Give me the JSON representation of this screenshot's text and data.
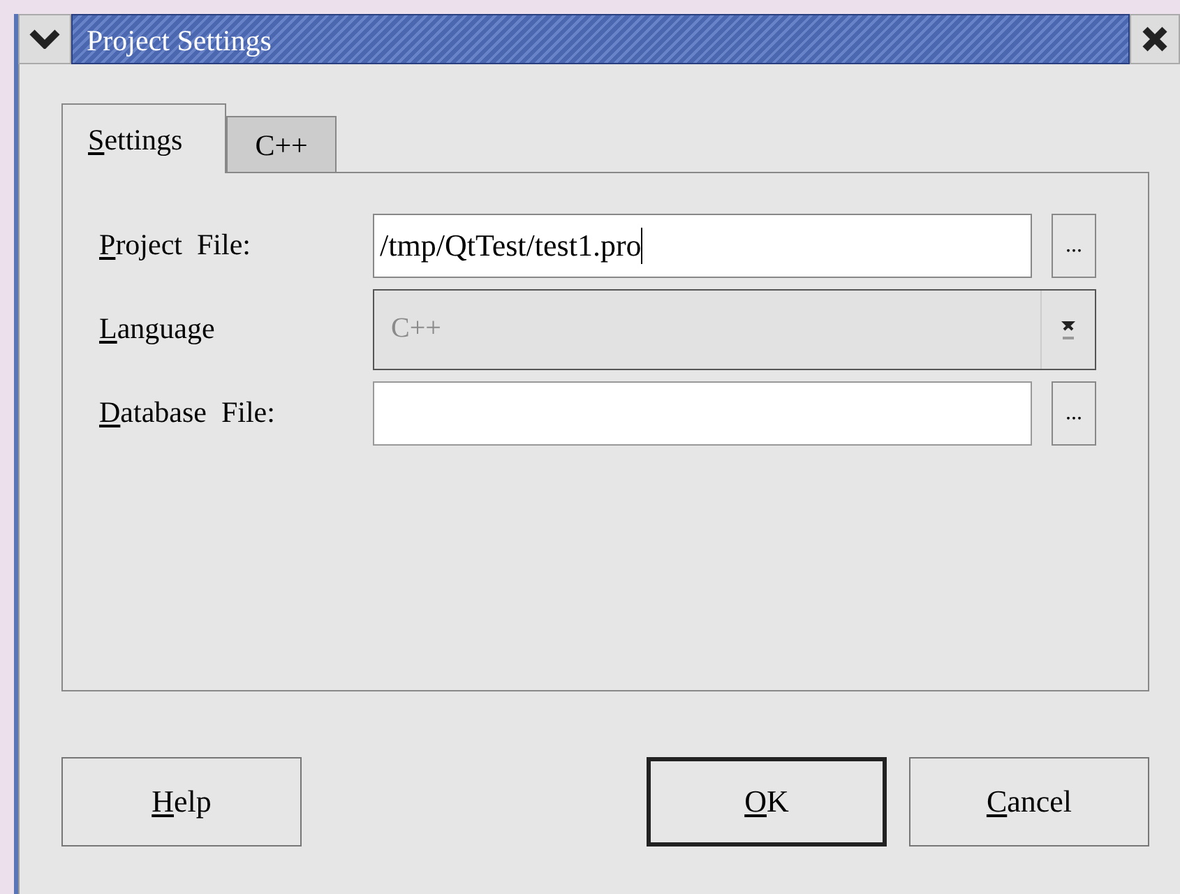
{
  "window": {
    "title": "Project Settings"
  },
  "tabs": [
    {
      "accel": "S",
      "rest": "ettings",
      "selected": true
    },
    {
      "rest": "C++",
      "selected": false
    }
  ],
  "fields": [
    {
      "kind": "file",
      "accel": "P",
      "rest": "roject  File:",
      "value": "/tmp/QtTest/test1.pro",
      "focused": true,
      "browse": "..."
    },
    {
      "kind": "combo",
      "accel": "L",
      "rest": "anguage",
      "value": "C++",
      "disabled": true
    },
    {
      "kind": "file",
      "accel": "D",
      "rest": "atabase  File:",
      "focused": false,
      "browse": "..."
    }
  ],
  "buttons": [
    {
      "accel": "H",
      "rest": "elp",
      "default": false
    },
    {
      "accel": "O",
      "rest": "K",
      "default": true
    },
    {
      "accel": "C",
      "rest": "ancel",
      "default": false
    }
  ]
}
